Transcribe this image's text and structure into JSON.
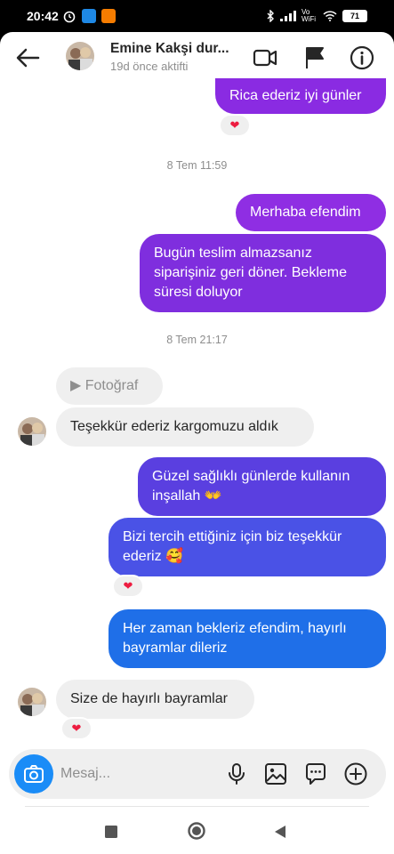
{
  "status_bar": {
    "time": "20:42",
    "battery": "71",
    "network": "Vo WiFi"
  },
  "header": {
    "name": "Emine Kakşi dur...",
    "status": "19d önce aktifti"
  },
  "messages": [
    {
      "text": "Rica ederiz iyi günler",
      "reaction": "❤"
    },
    {
      "timestamp": "8 Tem 11:59"
    },
    {
      "text": "Merhaba efendim"
    },
    {
      "text": "Bugün teslim almazsanız siparişiniz geri döner. Bekleme süresi doluyor"
    },
    {
      "timestamp": "8 Tem 21:17"
    },
    {
      "text": "▶ Fotoğraf"
    },
    {
      "text": "Teşekkür ederiz kargomuzu aldık"
    },
    {
      "text": "Güzel sağlıklı günlerde kullanın inşallah 👐"
    },
    {
      "text": "Bizi tercih ettiğiniz için biz teşekkür ederiz 🥰",
      "reaction": "❤"
    },
    {
      "text": "Her zaman bekleriz efendim, hayırlı bayramlar dileriz"
    },
    {
      "text": "Size de hayırlı bayramlar",
      "reaction": "❤"
    }
  ],
  "composer": {
    "placeholder": "Mesaj..."
  },
  "colors": {
    "bubble_purple": "#8a2be2",
    "bubble_mid": "#5b3fe0",
    "bubble_blue": "#1f6fe8",
    "incoming": "#efefef",
    "camera": "#1a8cf7",
    "heart": "#ed1c40"
  },
  "icons": {
    "header": [
      "back-arrow-icon",
      "video-call-icon",
      "flag-icon",
      "info-icon"
    ],
    "composer": [
      "camera-icon",
      "microphone-icon",
      "gallery-icon",
      "sticker-icon",
      "add-icon"
    ],
    "nav": [
      "recents-icon",
      "home-icon",
      "back-icon"
    ]
  }
}
